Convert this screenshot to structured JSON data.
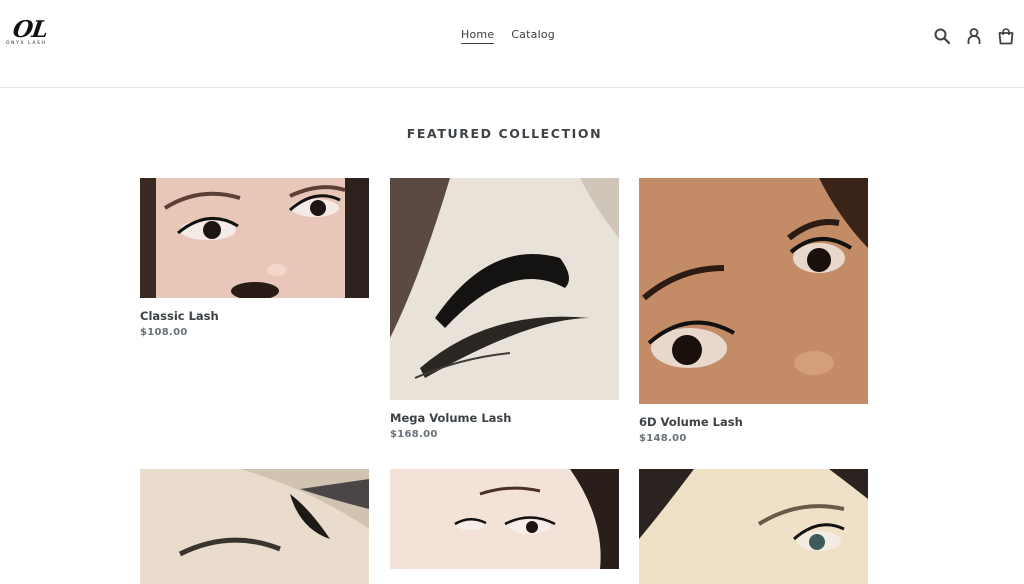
{
  "brand": {
    "logo_mark": "OL",
    "logo_text": "ONYX LASH"
  },
  "nav": {
    "items": [
      {
        "label": "Home"
      },
      {
        "label": "Catalog"
      }
    ]
  },
  "icons": {
    "search": "search-icon",
    "account": "account-icon",
    "cart": "cart-icon"
  },
  "featured": {
    "title": "FEATURED COLLECTION",
    "products": [
      {
        "title": "Classic Lash",
        "price": "$108.00"
      },
      {
        "title": "Mega Volume Lash",
        "price": "$168.00"
      },
      {
        "title": "6D Volume Lash",
        "price": "$148.00"
      },
      {
        "title": "",
        "price": ""
      },
      {
        "title": "",
        "price": ""
      },
      {
        "title": "",
        "price": ""
      }
    ]
  },
  "colors": {
    "text": "#3d4246",
    "price": "#69727b",
    "divider": "#e8e9eb",
    "background": "#ffffff"
  }
}
